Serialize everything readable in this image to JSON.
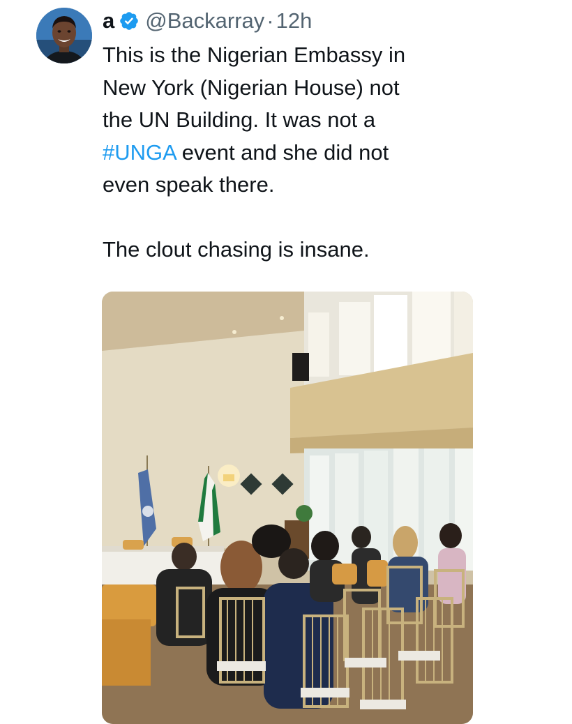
{
  "tweet": {
    "display_name": "a",
    "verified": true,
    "handle": "@Backarray",
    "separator": "·",
    "time": "12h",
    "text_lines": [
      "This is the Nigerian Embassy in",
      "New York (Nigerian House) not",
      "the UN Building. It was not a",
      "event and she did not",
      "even speak there."
    ],
    "hashtag": "#UNGA",
    "text_para2": "The clout chasing is insane."
  },
  "colors": {
    "text": "#0f1419",
    "secondary": "#536471",
    "hashtag": "#1d9bf0",
    "verified_badge": "#1d9bf0"
  },
  "icons": {
    "verified": "verified-badge-icon",
    "avatar": "profile-avatar"
  }
}
